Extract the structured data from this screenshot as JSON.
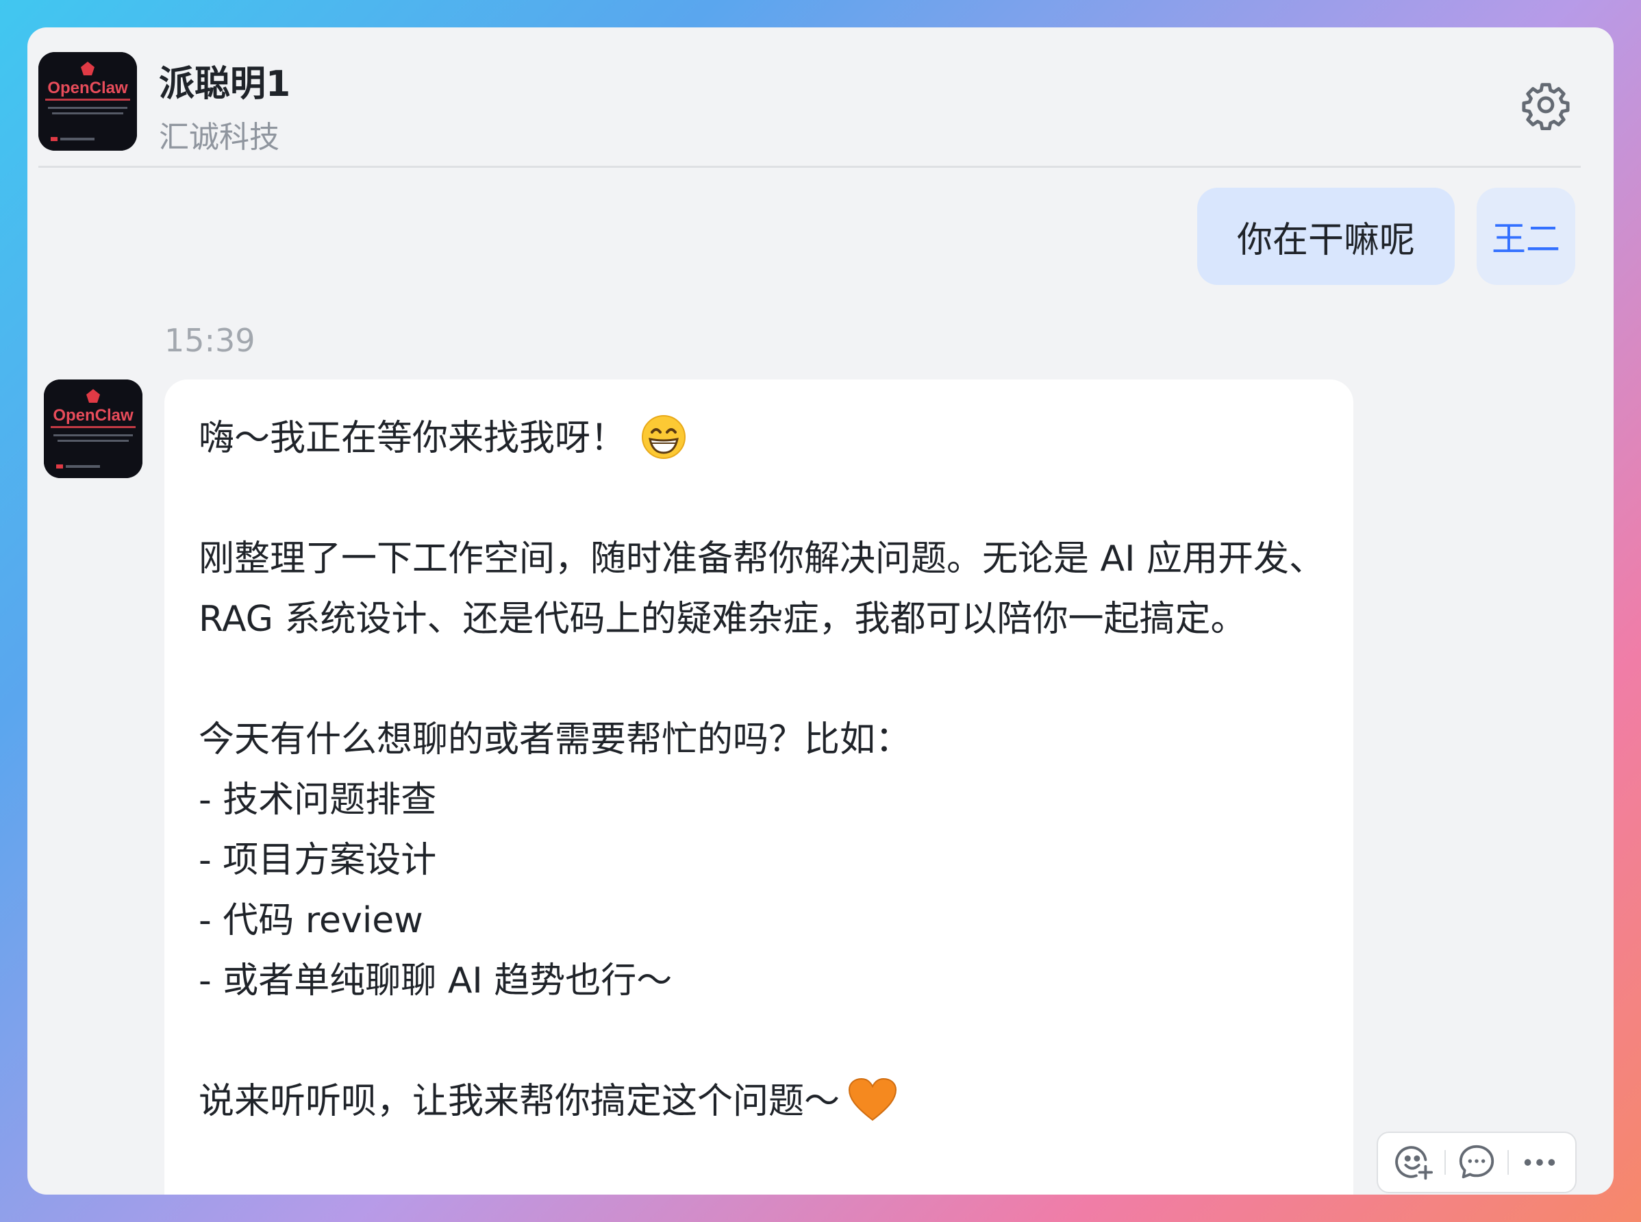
{
  "header": {
    "title": "派聪明1",
    "subtitle": "汇诚科技",
    "settings_icon": "gear-icon",
    "avatar_logo_text": "OpenClaw"
  },
  "conversation": {
    "user_message": "你在干嘛呢",
    "user_name": "王二",
    "timestamp": "15:39",
    "bot_message": {
      "line1": "嗨～我正在等你来找我呀！",
      "line1_emoji": "grinning-face",
      "paragraph2": "刚整理了一下工作空间，随时准备帮你解决问题。无论是 AI 应用开发、RAG 系统设计、还是代码上的疑难杂症，我都可以陪你一起搞定。",
      "paragraph3_intro": "今天有什么想聊的或者需要帮忙的吗？比如：",
      "bullets": [
        "- 技术问题排查",
        "- 项目方案设计",
        "- 代码 review",
        "- 或者单纯聊聊 AI 趋势也行～"
      ],
      "closing": "说来听听呗，让我来帮你搞定这个问题～",
      "closing_emoji": "orange-heart"
    }
  },
  "message_actions": [
    "add-reaction-icon",
    "reply-comment-icon",
    "more-icon"
  ],
  "colors": {
    "window_bg": "#f2f3f5",
    "user_bubble": "#d9e6fd",
    "user_name_color": "#3370ff",
    "bot_bubble": "#ffffff"
  }
}
